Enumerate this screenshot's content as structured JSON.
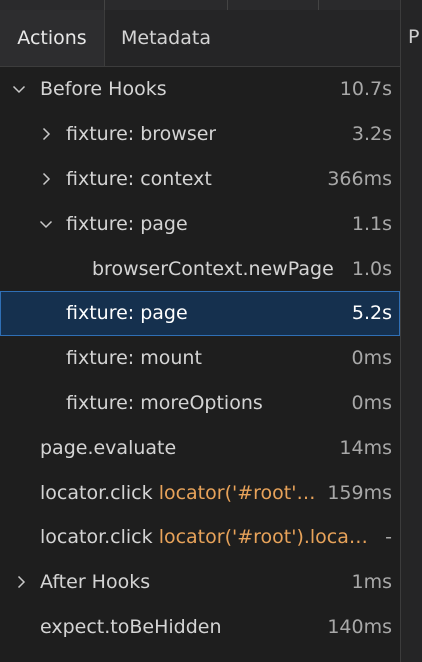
{
  "tabs": [
    {
      "label": "Actions",
      "active": true
    },
    {
      "label": "Metadata",
      "active": false
    }
  ],
  "right_pane": {
    "partial_text": "P"
  },
  "colors": {
    "accent_selected": "#15304e",
    "arg_orange": "#e8a35a"
  },
  "actions": [
    {
      "label": "Before Hooks",
      "arg": "",
      "duration": "10.7s",
      "chevron": "expanded"
    },
    {
      "label": "fixture: browser",
      "arg": "",
      "duration": "3.2s",
      "chevron": "collapsed"
    },
    {
      "label": "fixture: context",
      "arg": "",
      "duration": "366ms",
      "chevron": "collapsed"
    },
    {
      "label": "fixture: page",
      "arg": "",
      "duration": "1.1s",
      "chevron": "expanded"
    },
    {
      "label": "browserContext.newPage",
      "arg": "",
      "duration": "1.0s",
      "chevron": "none"
    },
    {
      "label": "fixture: page",
      "arg": "",
      "duration": "5.2s",
      "chevron": "none",
      "selected": true
    },
    {
      "label": "fixture: mount",
      "arg": "",
      "duration": "0ms",
      "chevron": "none"
    },
    {
      "label": "fixture: moreOptions",
      "arg": "",
      "duration": "0ms",
      "chevron": "none"
    },
    {
      "label": "page.evaluate",
      "arg": "",
      "duration": "14ms",
      "chevron": "none"
    },
    {
      "label": "locator.click",
      "arg": "locator('#root'…",
      "duration": "159ms",
      "chevron": "none"
    },
    {
      "label": "locator.click",
      "arg": "locator('#root').loca…",
      "duration": "-",
      "chevron": "none"
    },
    {
      "label": "After Hooks",
      "arg": "",
      "duration": "1ms",
      "chevron": "collapsed"
    },
    {
      "label": "expect.toBeHidden",
      "arg": "",
      "duration": "140ms",
      "chevron": "none"
    }
  ]
}
